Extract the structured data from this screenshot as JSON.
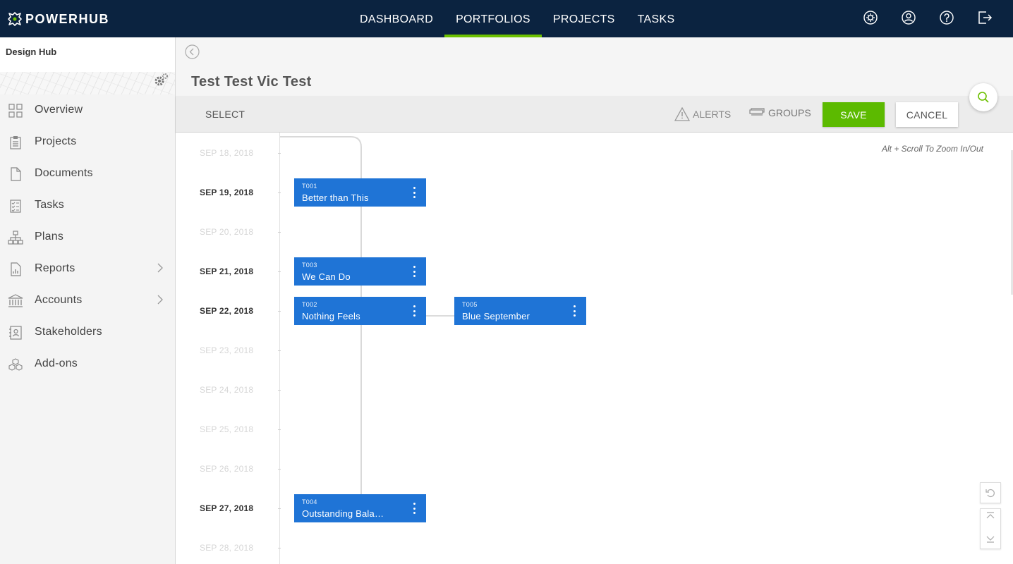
{
  "app": {
    "logo_text": "POWERHUB"
  },
  "topnav": {
    "items": [
      {
        "label": "DASHBOARD",
        "active": false
      },
      {
        "label": "PORTFOLIOS",
        "active": true
      },
      {
        "label": "PROJECTS",
        "active": false
      },
      {
        "label": "TASKS",
        "active": false
      }
    ],
    "icons": [
      "network-gear-icon",
      "user-icon",
      "help-icon",
      "logout-icon"
    ],
    "active_color": "#6cc000"
  },
  "sidebar": {
    "hub_title": "Design Hub",
    "items": [
      {
        "label": "Overview",
        "icon": "grid-icon"
      },
      {
        "label": "Projects",
        "icon": "clipboard-icon"
      },
      {
        "label": "Documents",
        "icon": "document-icon"
      },
      {
        "label": "Tasks",
        "icon": "checklist-icon"
      },
      {
        "label": "Plans",
        "icon": "hierarchy-icon"
      },
      {
        "label": "Reports",
        "icon": "report-icon",
        "chevron": true
      },
      {
        "label": "Accounts",
        "icon": "bank-icon",
        "chevron": true
      },
      {
        "label": "Stakeholders",
        "icon": "contact-icon"
      },
      {
        "label": "Add-ons",
        "icon": "cubes-icon"
      }
    ]
  },
  "main": {
    "title": "Test Test Vic Test",
    "toolbar": {
      "select_label": "SELECT",
      "alerts_label": "ALERTS",
      "groups_label": "GROUPS",
      "save_label": "SAVE",
      "cancel_label": "CANCEL"
    },
    "zoom_hint": "Alt + Scroll To Zoom In/Out",
    "dates": [
      {
        "label": "SEP 18, 2018",
        "emphasis": false
      },
      {
        "label": "SEP 19, 2018",
        "emphasis": true
      },
      {
        "label": "SEP 20, 2018",
        "emphasis": false
      },
      {
        "label": "SEP 21, 2018",
        "emphasis": true
      },
      {
        "label": "SEP 22, 2018",
        "emphasis": true
      },
      {
        "label": "SEP 23, 2018",
        "emphasis": false
      },
      {
        "label": "SEP 24, 2018",
        "emphasis": false
      },
      {
        "label": "SEP 25, 2018",
        "emphasis": false
      },
      {
        "label": "SEP 26, 2018",
        "emphasis": false
      },
      {
        "label": "SEP 27, 2018",
        "emphasis": true
      },
      {
        "label": "SEP 28, 2018",
        "emphasis": false
      }
    ],
    "tasks": [
      {
        "id": "T001",
        "name": "Better than This",
        "date": "SEP 19, 2018",
        "lane": 0
      },
      {
        "id": "T003",
        "name": "We Can Do",
        "date": "SEP 21, 2018",
        "lane": 0
      },
      {
        "id": "T002",
        "name": "Nothing Feels",
        "date": "SEP 22, 2018",
        "lane": 0
      },
      {
        "id": "T005",
        "name": "Blue September",
        "date": "SEP 22, 2018",
        "lane": 1
      },
      {
        "id": "T004",
        "name": "Outstanding Balance",
        "date": "SEP 27, 2018",
        "lane": 0
      }
    ],
    "task_color": "#1f74d6",
    "save_color": "#5cba00"
  }
}
